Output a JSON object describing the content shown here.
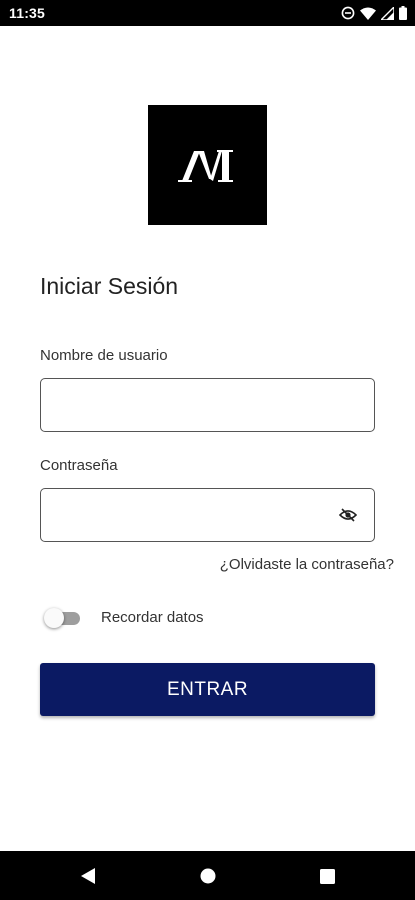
{
  "status_bar": {
    "time": "11:35",
    "icons": [
      "do-not-disturb-icon",
      "wifi-icon",
      "signal-icon",
      "battery-icon"
    ]
  },
  "logo": {
    "icon": "brand-logo-m",
    "background": "#000000"
  },
  "login": {
    "title": "Iniciar Sesión",
    "username": {
      "label": "Nombre de usuario",
      "value": "",
      "placeholder": ""
    },
    "password": {
      "label": "Contraseña",
      "value": "",
      "placeholder": "",
      "toggle_icon": "eye-off-icon"
    },
    "forgot_password": "¿Olvidaste la contraseña?",
    "remember": {
      "label": "Recordar datos",
      "checked": false
    },
    "submit_label": "ENTRAR"
  },
  "colors": {
    "primary_button": "#0b1a63",
    "system_bars": "#000000"
  },
  "nav_bar": {
    "buttons": [
      "back-icon",
      "home-icon",
      "recents-icon"
    ]
  }
}
